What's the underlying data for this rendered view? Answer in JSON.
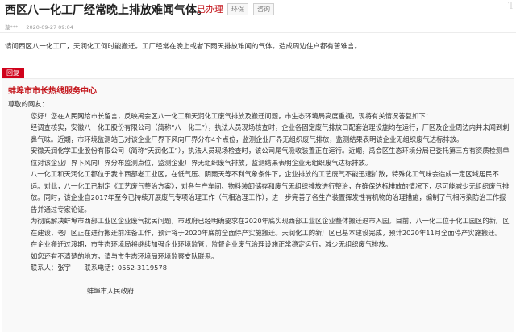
{
  "title": "西区八一化工厂经常晚上排放难闻气体。",
  "status": "已办理",
  "tags": [
    "环保",
    "咨询"
  ],
  "watermark": "T",
  "meta": {
    "author": "漩***",
    "time": "2020-09-27 09:04"
  },
  "question": "请问西区八一化工厂，天润化工何时能搬迁。工厂经常在晚上或者下雨天排放难闻的气体。造成周边住户都有苦难言。",
  "reply_badge": "回复",
  "reply": {
    "org": "蚌埠市市长热线服务中心",
    "greeting": "尊敬的网友：",
    "paragraphs": [
      "您好！您在人民网给市长留言，反映禹会区八一化工和天润化工废气排放及搬迁问题，市生态环境局高度重视，现将有关情况答复如下：",
      "经调查核实，安徽八一化工股份有限公司（简称“八一化工”），执法人员现场核查时，企业各固定废气排放口配套治理设施均在运行，厂区及企业周边内并未闻到刺鼻气味。近期，市环境监测站已对该企业厂界下风向厂界分布4个点位，监测企业厂界无组织废气排放，监测结果表明该企业无组织废气达标排放。",
      "安徽天润化学工业股份有限公司（简称“天润化工”），执法人员现场检查时，该公司尾气吸收装置正在运行。近期，禹会区生态环境分局已委托第三方有资质检测单位对该企业厂界下风向厂界分布监测点位，监测企业厂界无组织废气排放，监测结果表明企业无组织废气达标排放。",
      "八一化工和天润化工都位于我市西部老工业区，在低气压、阴雨天等不利气象条件下，企业排放的工艺废气不能迅速扩散，特殊化工气味会造成一定区域居民不适。对此，八一化工已制定《工艺废气整治方案》，对各生产车间、物料装卸储存和废气无组织排放进行整治，在确保达标排放的情况下，尽可能减少无组织废气排放。同时，该企业自2017年至今已持续开展废气专项治理工作（气相治理工作），进一步完善了各生产装置挥发性有机物的治理措施，编制了气相污染防治工作报告并通过专家论证。",
      "为彻底解决蚌埠市西部工业区企业废气扰民问题，市政府已经明确要求在2020年底实现西部工业区企业整体搬迁退市入园。目前，八一化工位于化工园区的新厂区在建设，老厂区正在进行搬迁前准备工作，预计将于2020年底前全面停产实施搬迁。天润化工的新厂区已基本建设完成，预计2020年11月全面停产实施搬迁。",
      "在企业搬迁过渡期，市生态环境局将继续加强企业环境监管，监督企业废气治理设施正常稳定运行，减少无组织废气排放。",
      "如您还有不清楚的地方，请与市生态环境局环境监察支队联系。"
    ],
    "contact_person": "联系人：张宇",
    "contact_phone": "联系电话：0552-3119578",
    "signature": "蚌埠市人民政府"
  }
}
